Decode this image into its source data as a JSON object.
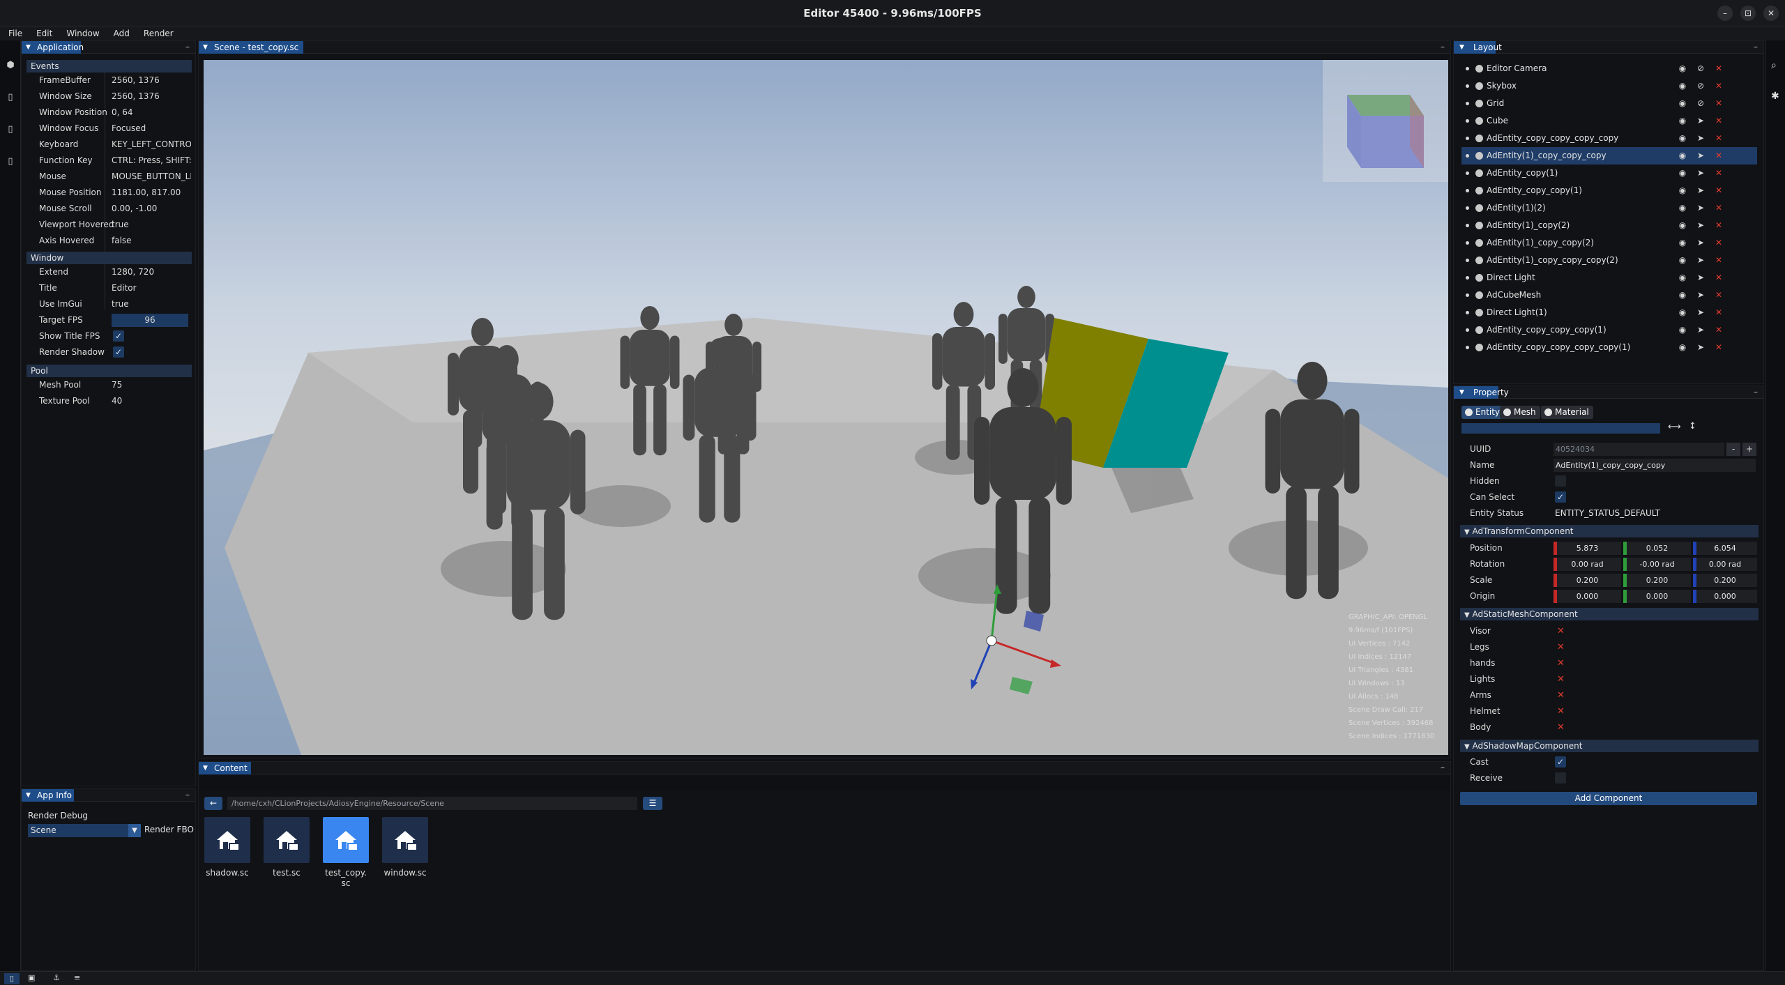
{
  "window": {
    "title": "Editor 45400 - 9.96ms/100FPS",
    "controls": {
      "minimize": "–",
      "maximize": "⊡",
      "close": "✕"
    }
  },
  "menubar": [
    "File",
    "Edit",
    "Window",
    "Add",
    "Render"
  ],
  "application_panel": {
    "tab": "Application",
    "events_header": "Events",
    "events": [
      {
        "label": "FrameBuffer",
        "value": "2560, 1376"
      },
      {
        "label": "Window Size",
        "value": "2560, 1376"
      },
      {
        "label": "Window Position",
        "value": "0, 64"
      },
      {
        "label": "Window Focus",
        "value": "Focused"
      },
      {
        "label": "Keyboard",
        "value": "KEY_LEFT_CONTROL, P"
      },
      {
        "label": "Function Key",
        "value": "CTRL: Press, SHIFT: Re"
      },
      {
        "label": "Mouse",
        "value": "MOUSE_BUTTON_LEFT"
      },
      {
        "label": "Mouse Position",
        "value": "1181.00, 817.00"
      },
      {
        "label": "Mouse Scroll",
        "value": "0.00, -1.00"
      },
      {
        "label": "Viewport Hovered",
        "value": "true"
      },
      {
        "label": "Axis Hovered",
        "value": "false"
      }
    ],
    "window_header": "Window",
    "window_rows": [
      {
        "label": "Extend",
        "value": "1280, 720"
      },
      {
        "label": "Title",
        "value": "Editor"
      },
      {
        "label": "Use ImGui",
        "value": "true"
      },
      {
        "label": "Target FPS",
        "value": "96"
      },
      {
        "label": "Show Title FPS",
        "checked": true
      },
      {
        "label": "Render Shadow",
        "checked": true
      }
    ],
    "pool_header": "Pool",
    "pool_rows": [
      {
        "label": "Mesh Pool",
        "value": "75"
      },
      {
        "label": "Texture Pool",
        "value": "40"
      }
    ]
  },
  "app_info_panel": {
    "tab": "App Info",
    "render_debug_label": "Render Debug",
    "render_debug_select": "Scene",
    "render_fbo_label": "Render FBO"
  },
  "scene_panel": {
    "tab": "Scene - test_copy.sc",
    "overlay_stats": [
      "GRAPHIC_API: OPENGL",
      "9.96ms/f (101FPS)",
      "UI Vertices : 7142",
      "UI Indices : 12147",
      "UI Triangles : 4381",
      "UI Windows : 13",
      "UI Allocs : 148",
      "Scene Draw Call: 217",
      "Scene Vertices : 392468",
      "Scene Indices : 1771830"
    ]
  },
  "content_panel": {
    "tab": "Content",
    "path": "/home/cxh/CLionProjects/AdiosyEngine/Resource/Scene",
    "files": [
      {
        "name": "shadow.sc",
        "selected": false
      },
      {
        "name": "test.sc",
        "selected": false
      },
      {
        "name": "test_copy.\nsc",
        "selected": true
      },
      {
        "name": "window.sc",
        "selected": false
      }
    ]
  },
  "layout_panel": {
    "tab": "Layout",
    "entities": [
      {
        "name": "Editor Camera",
        "selected": false,
        "lock": true
      },
      {
        "name": "Skybox",
        "selected": false,
        "lock": true
      },
      {
        "name": "Grid",
        "selected": false,
        "lock": true
      },
      {
        "name": "Cube",
        "selected": false,
        "lock": false
      },
      {
        "name": "AdEntity_copy_copy_copy_copy",
        "selected": false,
        "lock": false
      },
      {
        "name": "AdEntity(1)_copy_copy_copy",
        "selected": true,
        "lock": false
      },
      {
        "name": "AdEntity_copy(1)",
        "selected": false,
        "lock": false
      },
      {
        "name": "AdEntity_copy_copy(1)",
        "selected": false,
        "lock": false
      },
      {
        "name": "AdEntity(1)(2)",
        "selected": false,
        "lock": false
      },
      {
        "name": "AdEntity(1)_copy(2)",
        "selected": false,
        "lock": false
      },
      {
        "name": "AdEntity(1)_copy_copy(2)",
        "selected": false,
        "lock": false
      },
      {
        "name": "AdEntity(1)_copy_copy_copy(2)",
        "selected": false,
        "lock": false
      },
      {
        "name": "Direct Light",
        "selected": false,
        "lock": false
      },
      {
        "name": "AdCubeMesh",
        "selected": false,
        "lock": false
      },
      {
        "name": "Direct Light(1)",
        "selected": false,
        "lock": false
      },
      {
        "name": "AdEntity_copy_copy_copy(1)",
        "selected": false,
        "lock": false
      },
      {
        "name": "AdEntity_copy_copy_copy_copy(1)",
        "selected": false,
        "lock": false
      }
    ]
  },
  "property_panel": {
    "tab": "Property",
    "tabs": [
      "Entity",
      "Mesh",
      "Material"
    ],
    "uuid_label": "UUID",
    "uuid": "40524034",
    "uuid_minus": "-",
    "uuid_plus": "+",
    "name_label": "Name",
    "name": "AdEntity(1)_copy_copy_copy",
    "hidden_label": "Hidden",
    "can_select_label": "Can Select",
    "entity_status_label": "Entity Status",
    "entity_status": "ENTITY_STATUS_DEFAULT",
    "transform_header": "AdTransformComponent",
    "transform": [
      {
        "label": "Position",
        "x": "5.873",
        "y": "0.052",
        "z": "6.054"
      },
      {
        "label": "Rotation",
        "x": "0.00 rad",
        "y": "-0.00 rad",
        "z": "0.00 rad"
      },
      {
        "label": "Scale",
        "x": "0.200",
        "y": "0.200",
        "z": "0.200"
      },
      {
        "label": "Origin",
        "x": "0.000",
        "y": "0.000",
        "z": "0.000"
      }
    ],
    "mesh_header": "AdStaticMeshComponent",
    "mesh_parts": [
      "Visor",
      "Legs",
      "hands",
      "Lights",
      "Arms",
      "Helmet",
      "Body"
    ],
    "shadow_header": "AdShadowMapComponent",
    "cast_label": "Cast",
    "receive_label": "Receive",
    "add_component": "Add Component"
  },
  "colors": {
    "accent": "#1e4d8a",
    "selection": "#1f3c66",
    "delete": "#e23b2e",
    "axis_x": "#c62828",
    "axis_y": "#2e9d3a",
    "axis_z": "#2142b5"
  }
}
